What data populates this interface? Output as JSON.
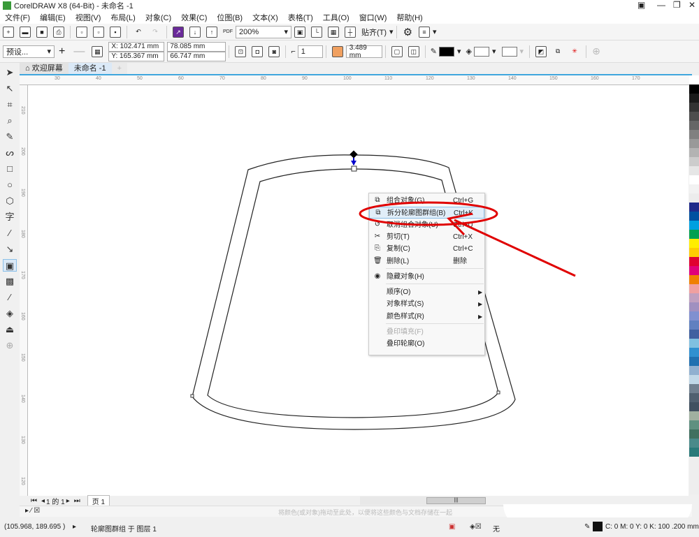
{
  "window": {
    "title": "CorelDRAW X8 (64-Bit) - 未命名 -1"
  },
  "menubar": [
    "文件(F)",
    "编辑(E)",
    "视图(V)",
    "布局(L)",
    "对象(C)",
    "效果(C)",
    "位图(B)",
    "文本(X)",
    "表格(T)",
    "工具(O)",
    "窗口(W)",
    "帮助(H)"
  ],
  "toolbar": {
    "zoom": "200%",
    "snap": "贴齐(T)",
    "pdf": "PDF"
  },
  "propbar": {
    "preset": "预设...",
    "x": "X: 102.471 mm",
    "y": "Y: 165.367 mm",
    "width": "78.085 mm",
    "height": "66.747 mm",
    "steps": "1",
    "offset": "3.489 mm",
    "outline_color": "#000000"
  },
  "tabs": [
    {
      "label": "欢迎屏幕"
    },
    {
      "label": "未命名 -1"
    }
  ],
  "ruler": {
    "h": [
      "30",
      "40",
      "50",
      "60",
      "70",
      "80",
      "90",
      "100",
      "110",
      "120",
      "130",
      "140",
      "150",
      "160",
      "170"
    ],
    "v": [
      "210",
      "200",
      "190",
      "180",
      "170",
      "160",
      "150",
      "140",
      "130",
      "120"
    ]
  },
  "context_menu": {
    "items": [
      {
        "label": "组合对象(G)",
        "shortcut": "Ctrl+G"
      },
      {
        "label": "拆分轮廓图群组(B)",
        "shortcut": "Ctrl+K",
        "highlighted": true
      },
      {
        "label": "取消组合对象(U)",
        "shortcut": "Ctrl+U"
      },
      {
        "label": "剪切(T)",
        "shortcut": "Ctrl+X"
      },
      {
        "label": "复制(C)",
        "shortcut": "Ctrl+C"
      },
      {
        "label": "删除(L)",
        "shortcut": "删除"
      },
      {
        "label": "隐藏对象(H)"
      },
      {
        "label": "顺序(O)",
        "submenu": true
      },
      {
        "label": "对象样式(S)",
        "submenu": true
      },
      {
        "label": "颜色样式(R)",
        "submenu": true
      },
      {
        "label": "叠印填充(F)",
        "disabled": true
      },
      {
        "label": "叠印轮廓(O)"
      }
    ]
  },
  "pagebar": {
    "pages": "1 的 1",
    "page_tab": "页 1"
  },
  "docpalette": {
    "hint": "将颜色(或对象)拖动至此处，以便将这些颜色与文档存储在一起"
  },
  "status": {
    "coords": "(105.968, 189.695 )",
    "info": "轮廓图群组 于 图层 1",
    "fill": "无",
    "outline": "C: 0 M: 0 Y: 0 K: 100  .200 mm"
  },
  "colors": {
    "accent": "#3fa6dd",
    "annotation": "#e00000",
    "palette": [
      "#ffffff",
      "#000000",
      "#1a1a1a",
      "#333333",
      "#4d4d4d",
      "#666666",
      "#808080",
      "#999999",
      "#b3b3b3",
      "#cccccc",
      "#e6e6e6",
      "#ffffff",
      "#f2f2f2",
      "#ececec",
      "#1f2a8a",
      "#0050a0",
      "#00a0e0",
      "#00a050",
      "#ffee00",
      "#ffcc00",
      "#e00030",
      "#e0007a",
      "#f08000",
      "#f0a0a0",
      "#c0a0c0",
      "#a090c0",
      "#8090d0",
      "#6080c0",
      "#4060a0",
      "#80c0e0",
      "#3090d0",
      "#2070b0",
      "#90b0d0",
      "#c0d8e8",
      "#708090",
      "#506070",
      "#405060",
      "#a0b0a0",
      "#609080",
      "#407060",
      "#4a8a8a",
      "#2a7a7a"
    ]
  }
}
